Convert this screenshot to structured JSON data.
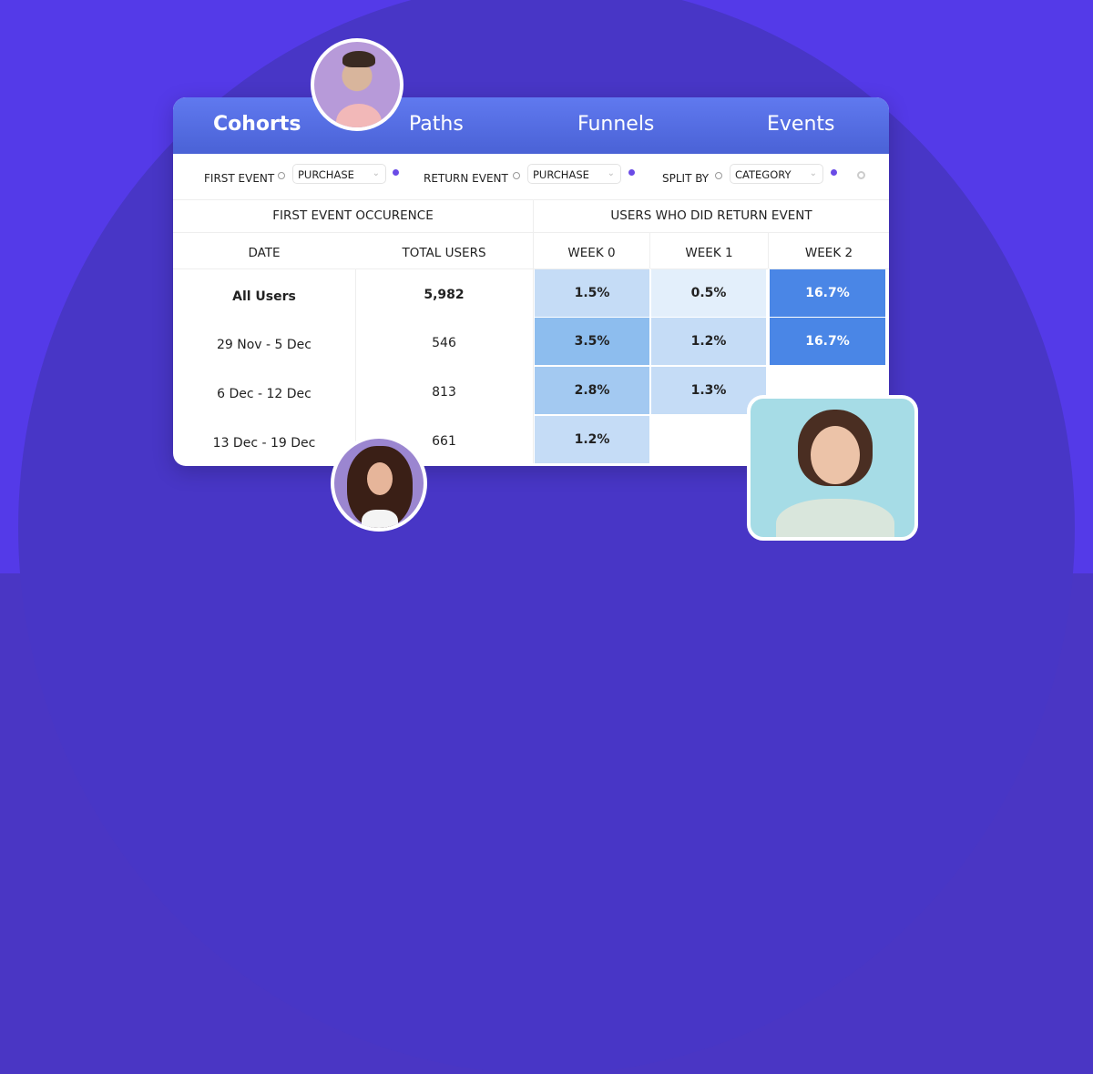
{
  "tabs": [
    {
      "label": "Cohorts",
      "active": true
    },
    {
      "label": "Paths",
      "active": false
    },
    {
      "label": "Funnels",
      "active": false
    },
    {
      "label": "Events",
      "active": false
    }
  ],
  "filters": {
    "first_event": {
      "label": "FIRST EVENT",
      "value": "PURCHASE"
    },
    "return_event": {
      "label": "RETURN EVENT",
      "value": "PURCHASE"
    },
    "split_by": {
      "label": "SPLIT BY",
      "value": "CATEGORY"
    }
  },
  "table": {
    "group_left": "FIRST EVENT OCCURENCE",
    "group_right": "USERS WHO DID RETURN EVENT",
    "columns": [
      "DATE",
      "TOTAL USERS",
      "WEEK 0",
      "WEEK 1",
      "WEEK 2"
    ],
    "rows": [
      {
        "date": "All Users",
        "total": "5,982",
        "weeks": [
          "1.5%",
          "0.5%",
          "16.7%"
        ],
        "bold": true
      },
      {
        "date": "29 Nov - 5 Dec",
        "total": "546",
        "weeks": [
          "3.5%",
          "1.2%",
          "16.7%"
        ]
      },
      {
        "date": "6 Dec - 12 Dec",
        "total": "813",
        "weeks": [
          "2.8%",
          "1.3%",
          ""
        ]
      },
      {
        "date": "13 Dec - 19 Dec",
        "total": "661",
        "weeks": [
          "1.2%",
          "",
          ""
        ]
      }
    ],
    "heat_colors": {
      "1.5%": "#c5dcf6",
      "0.5%": "#e3effb",
      "16.7%": "#4a86e6",
      "3.5%": "#8dbdee",
      "1.2%": "#c5dcf6",
      "2.8%": "#a3c9f1",
      "1.3%": "#c5dcf6"
    }
  },
  "colors": {
    "background": "#543ae8",
    "accent": "#6a4be6",
    "tab_bar": "#5a72e8"
  }
}
